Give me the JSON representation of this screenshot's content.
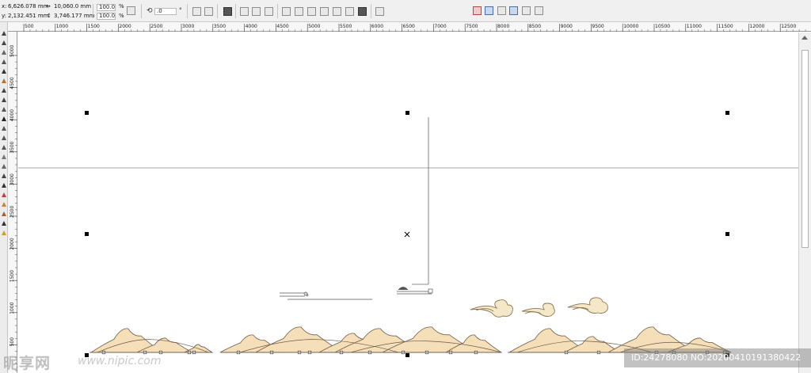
{
  "property_bar": {
    "x_label": "x:",
    "x_value": "6,626.078 mm",
    "y_label": "y:",
    "y_value": "2,132.451 mm",
    "width_value": "10,060.0 mm",
    "height_value": "3,746.177 mm",
    "scale_x": "100.0",
    "scale_y": "100.0",
    "percent_sign": "%",
    "rotation_value": ".0",
    "degree_sign": "°"
  },
  "ruler": {
    "horizontal_labels": [
      "500",
      "1000",
      "1500",
      "2000",
      "2500",
      "3000",
      "3500",
      "4000",
      "4500",
      "5000",
      "5500",
      "6000",
      "6500",
      "7000",
      "7500",
      "8000",
      "8500",
      "9000",
      "9500",
      "10000",
      "10500",
      "11000",
      "11500",
      "12000",
      "12500"
    ],
    "vertical_labels": [
      "5000",
      "4500",
      "4000",
      "3500",
      "3000",
      "2500",
      "2000",
      "1500",
      "1000",
      "500"
    ]
  },
  "canvas": {
    "fill_color": "#f5dfb8",
    "stroke_color": "#6a5a4a",
    "guide_color": "#888888"
  },
  "watermark": {
    "logo_text": "昵享网",
    "url_text": "www.nipic.com",
    "id_text": "ID:24278080 NO:20200410191380422"
  },
  "icons": {
    "rotation": "rotate-icon",
    "width": "width-icon",
    "height": "height-icon",
    "lock": "lock-ratio-icon"
  }
}
